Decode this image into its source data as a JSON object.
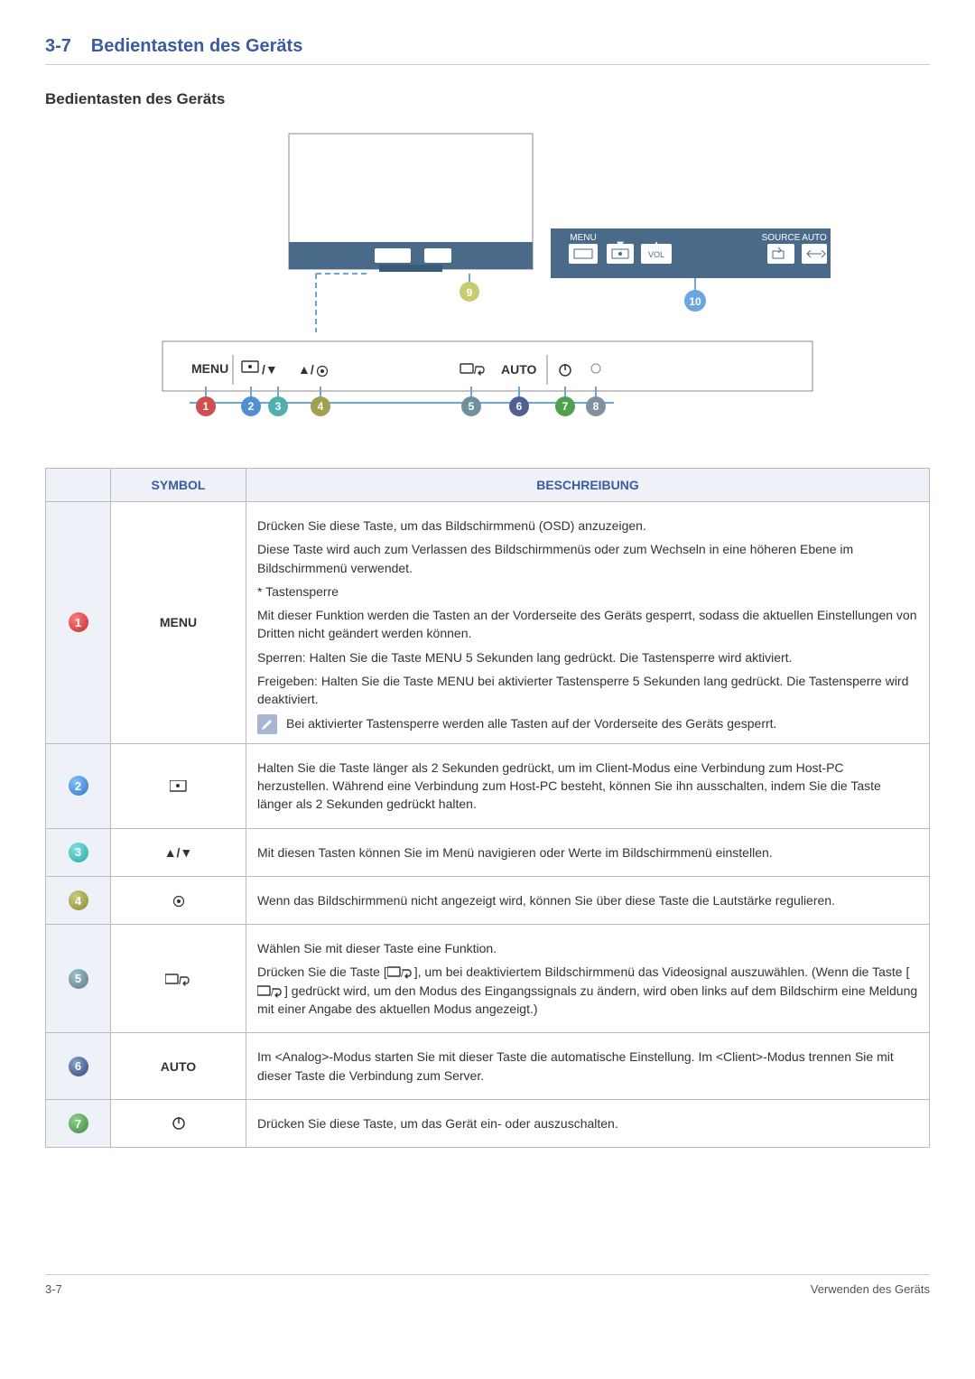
{
  "header": {
    "section_num": "3-7",
    "section_title": "Bedientasten des Geräts",
    "sub_title": "Bedientasten des Geräts"
  },
  "figure": {
    "left_strip_labels": [
      "MENU",
      "VOL",
      "SOURCE",
      "AUTO"
    ],
    "callouts_top": [
      "9",
      "10"
    ],
    "bottom_bar_labels": [
      "MENU",
      "AUTO"
    ],
    "callouts_bottom": [
      "1",
      "2",
      "3",
      "4",
      "5",
      "6",
      "7",
      "8"
    ]
  },
  "table": {
    "head_symbol": "SYMBOL",
    "head_desc": "BESCHREIBUNG",
    "rows": [
      {
        "num": "1",
        "badge": "b-red",
        "symbol_text": "MENU",
        "desc": [
          "Drücken Sie diese Taste, um das Bildschirmmenü (OSD) anzuzeigen.",
          "Diese Taste wird auch zum Verlassen des Bildschirmmenüs oder zum Wechseln in eine höheren Ebene im Bildschirmmenü verwendet.",
          "* Tastensperre",
          "Mit dieser Funktion werden die Tasten an der Vorderseite des Geräts gesperrt, sodass die aktuellen Einstellungen von Dritten nicht geändert werden können.",
          "Sperren: Halten Sie die Taste MENU 5 Sekunden lang gedrückt. Die Tastensperre wird aktiviert.",
          "Freigeben: Halten Sie die Taste MENU bei aktivierter Tastensperre 5 Sekunden lang gedrückt. Die Tastensperre wird deaktiviert."
        ],
        "note": "Bei aktivierter Tastensperre werden alle Tasten auf der Vorderseite des Geräts gesperrt."
      },
      {
        "num": "2",
        "badge": "b-blue",
        "symbol_svg": "monitor-connect-icon",
        "desc": [
          "Halten Sie die Taste länger als 2 Sekunden gedrückt, um im Client-Modus eine Verbindung zum Host-PC herzustellen. Während eine Verbindung zum Host-PC besteht, können Sie ihn ausschalten, indem Sie die Taste länger als 2 Sekunden gedrückt halten."
        ]
      },
      {
        "num": "3",
        "badge": "b-teal",
        "symbol_text": "▲/▼",
        "desc": [
          "Mit diesen Tasten können Sie im Menü navigieren oder Werte im Bildschirmmenü einstellen."
        ]
      },
      {
        "num": "4",
        "badge": "b-olive",
        "symbol_svg": "dot-target-icon",
        "desc": [
          "Wenn das Bildschirmmenü nicht angezeigt wird, können Sie über diese Taste die Lautstärke regulieren."
        ]
      },
      {
        "num": "5",
        "badge": "b-slate",
        "symbol_svg": "source-enter-icon",
        "desc_html": "row5"
      },
      {
        "num": "6",
        "badge": "b-navy",
        "symbol_text": "AUTO",
        "desc": [
          "Im <Analog>-Modus starten Sie mit dieser Taste die automatische Einstellung. Im <Client>-Modus trennen Sie mit dieser Taste die Verbindung zum Server."
        ]
      },
      {
        "num": "7",
        "badge": "b-green",
        "symbol_svg": "power-icon",
        "desc": [
          "Drücken Sie diese Taste, um das Gerät ein- oder auszuschalten."
        ]
      }
    ],
    "row5_desc": {
      "p1": "Wählen Sie mit dieser Taste eine Funktion.",
      "p2_a": "Drücken Sie die Taste [",
      "p2_b": "], um bei deaktiviertem Bildschirmmenü das Videosignal auszuwählen. (Wenn die Taste [",
      "p2_c": "] gedrückt wird, um den Modus des Eingangssignals zu ändern, wird oben links auf dem Bildschirm eine Meldung mit einer Angabe des aktuellen Modus angezeigt.)"
    }
  },
  "footer": {
    "left": "3-7",
    "right": "Verwenden des Geräts"
  }
}
